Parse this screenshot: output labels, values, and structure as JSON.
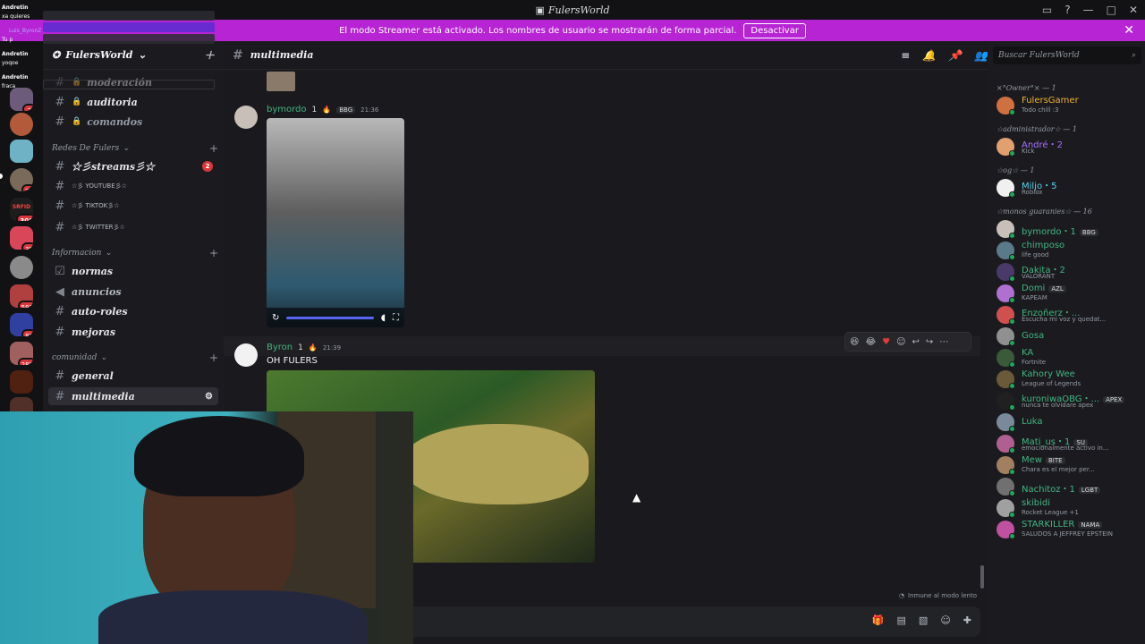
{
  "window": {
    "title": "FulersWorld"
  },
  "banner": {
    "text": "El modo Streamer está activado. Los nombres de usuario se mostrarán de forma parcial.",
    "button": "Desactivar"
  },
  "overlay": {
    "lines": [
      "Andretin",
      "xa quieres",
      "Luis_ByronZ",
      "Tu p",
      "Andretin",
      "yoqoe",
      "Andretin",
      "fraca"
    ]
  },
  "rail": {
    "badges": [
      "2",
      "33",
      "306",
      "35",
      "591",
      "82",
      "283"
    ],
    "server_label": "SRFID"
  },
  "server": {
    "name": "FulersWorld"
  },
  "channels": {
    "top": [
      {
        "label": "moderación"
      },
      {
        "label": "auditoria"
      },
      {
        "label": "comandos"
      }
    ],
    "cat_redes": "Redes De Fulers",
    "redes": [
      {
        "label": "☆彡streams彡☆",
        "count": "2"
      },
      {
        "label": "☆彡 YOUTUBE彡☆"
      },
      {
        "label": "☆彡 TIKTOK彡☆"
      },
      {
        "label": "☆彡 TWITTER彡☆"
      }
    ],
    "cat_info": "Informacion",
    "info": [
      {
        "label": "normas"
      },
      {
        "label": "anuncios"
      },
      {
        "label": "auto-roles"
      },
      {
        "label": "mejoras"
      }
    ],
    "cat_comunidad": "comunidad",
    "comunidad": [
      {
        "label": "general"
      },
      {
        "label": "multimedia"
      }
    ]
  },
  "chat": {
    "channel": "multimedia",
    "messages": [
      {
        "author": "bymordo",
        "streak": "1",
        "tag": "BBG",
        "time": "21:36"
      },
      {
        "author": "Byron",
        "streak": "1",
        "time": "21:39",
        "text": "OH FULERS"
      }
    ],
    "slowmode": "Inmune al modo lento"
  },
  "members": {
    "search_placeholder": "Buscar FulersWorld",
    "groups": [
      {
        "title": "×°Owner°× — 1",
        "items": [
          {
            "name": "FulersGamer",
            "status": "Todo chill :3",
            "color": "#f0b232"
          }
        ]
      },
      {
        "title": "☆administrador☆ — 1",
        "items": [
          {
            "name": "André・2",
            "status": "Kick",
            "color": "#a970ff"
          }
        ]
      },
      {
        "title": "☆og☆ — 1",
        "items": [
          {
            "name": "Miljo・5",
            "status": "Roblox",
            "color": "#5ad1f0"
          }
        ]
      },
      {
        "title": "☆monos guaranies☆ — 16",
        "items": [
          {
            "name": "bymordo・1",
            "status": "",
            "tag": "BBG",
            "color": "#43b581"
          },
          {
            "name": "chimposo",
            "status": "life good",
            "color": "#43b581"
          },
          {
            "name": "Dakita・2",
            "status": "VALORANT",
            "color": "#43b581"
          },
          {
            "name": "Domi",
            "status": "KAPEAM",
            "tag": "AZL",
            "color": "#43b581"
          },
          {
            "name": "Enzoñerz・...",
            "status": "Escucha mi voz y quedat...",
            "color": "#43b581"
          },
          {
            "name": "Gosa",
            "status": "",
            "color": "#43b581"
          },
          {
            "name": "KA",
            "status": "Fortnite",
            "color": "#43b581"
          },
          {
            "name": "Kahory Wee",
            "status": "League of Legends",
            "color": "#43b581"
          },
          {
            "name": "kuroniwaOBG・...",
            "status": "nunca te olvidare apex",
            "tag": "APEX",
            "color": "#43b581"
          },
          {
            "name": "Luka",
            "status": "",
            "color": "#43b581"
          },
          {
            "name": "Mati_us・1",
            "status": "emocionalmente activo in...",
            "tag": "SU",
            "color": "#43b581"
          },
          {
            "name": "Mew",
            "status": "Chara es el mejor per...",
            "tag": "BITE",
            "color": "#43b581"
          },
          {
            "name": "Nachitoz・1",
            "status": "",
            "tag": "LGBT",
            "color": "#43b581"
          },
          {
            "name": "skibidi",
            "status": "Rocket League +1",
            "color": "#43b581"
          },
          {
            "name": "STARKILLER",
            "status": "SALUDOS A JEFFREY EPSTEIN",
            "tag": "NAMA",
            "color": "#43b581"
          }
        ]
      }
    ]
  }
}
